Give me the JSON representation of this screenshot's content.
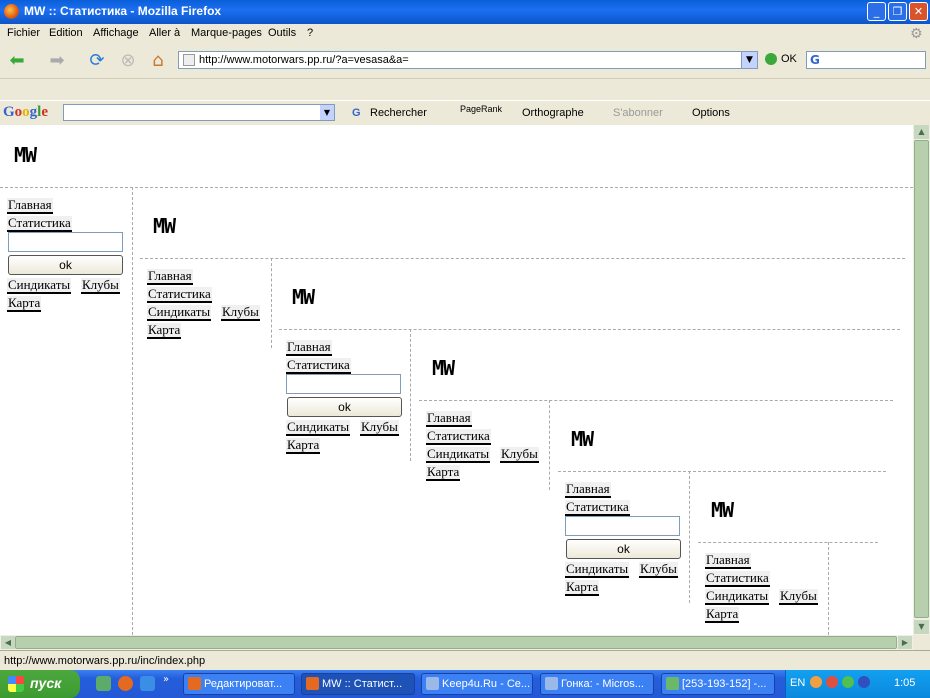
{
  "window": {
    "title": "MW :: Статистика - Mozilla Firefox"
  },
  "menu": [
    "Fichier",
    "Edition",
    "Affichage",
    "Aller à",
    "Marque-pages",
    "Outils",
    "?"
  ],
  "nav": {
    "url": "http://www.motorwars.pp.ru/?a=vesasa&a=",
    "go_label": "OK"
  },
  "googlebar": {
    "logo": "Google",
    "search_label": "Rechercher",
    "pagerank_label": "PageRank",
    "spell_label": "Orthographe",
    "subscribe_label": "S'abonner",
    "options_label": "Options"
  },
  "page": {
    "logo": "MW",
    "links": {
      "main": "Главная",
      "stats": "Статистика",
      "syndicates": "Синдикаты",
      "clubs": "Клубы",
      "map": "Карта"
    },
    "search_button": "ok"
  },
  "status": {
    "text": "http://www.motorwars.pp.ru/inc/index.php"
  },
  "taskbar": {
    "start": "пуск",
    "buttons": [
      "Редактироват...",
      "MW :: Статист...",
      "Keep4u.Ru - Се...",
      "Гонка: - Micros...",
      "[253-193-152] -..."
    ],
    "lang": "EN",
    "clock": "1:05"
  }
}
